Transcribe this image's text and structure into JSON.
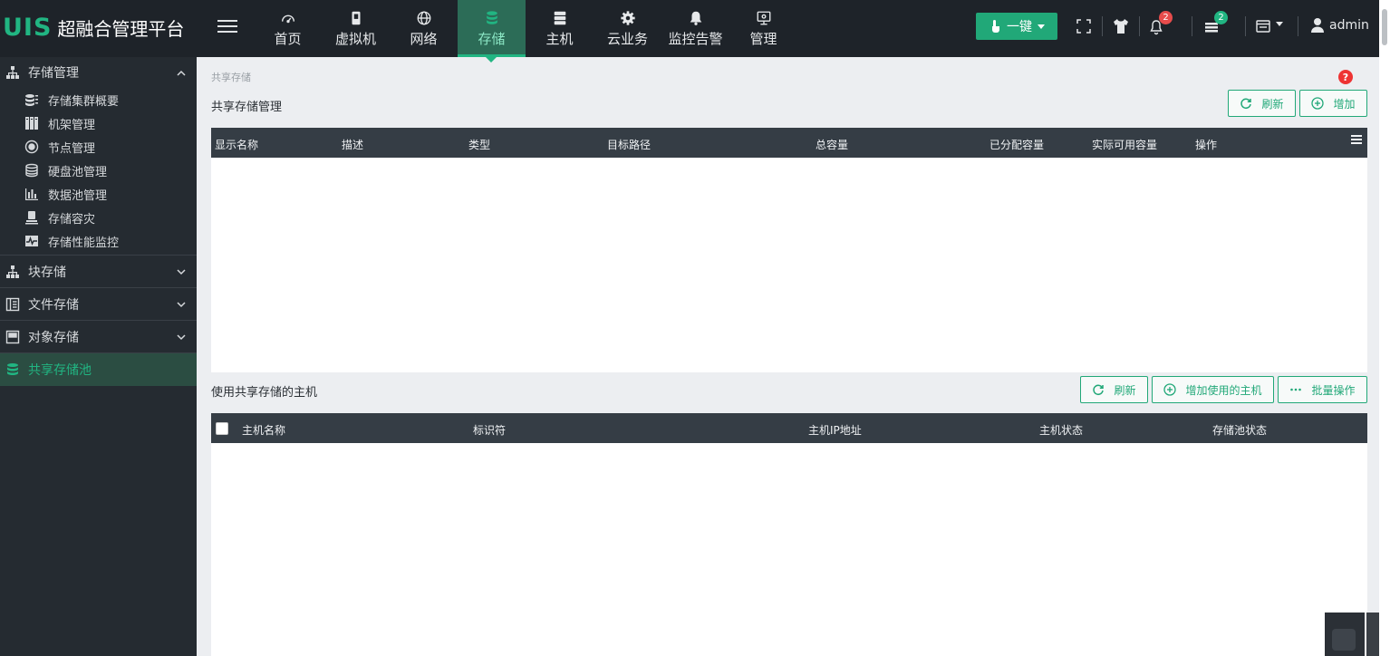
{
  "app": {
    "logo_mark": "UIS",
    "title": "超融合管理平台"
  },
  "nav": [
    {
      "label": "首页",
      "icon": "dashboard-icon"
    },
    {
      "label": "虚拟机",
      "icon": "vm-icon"
    },
    {
      "label": "网络",
      "icon": "globe-icon"
    },
    {
      "label": "存储",
      "icon": "database-icon",
      "active": true
    },
    {
      "label": "主机",
      "icon": "server-icon"
    },
    {
      "label": "云业务",
      "icon": "gear-icon"
    },
    {
      "label": "监控告警",
      "icon": "bell-alert-icon"
    },
    {
      "label": "管理",
      "icon": "monitor-icon"
    }
  ],
  "toolbar": {
    "yijian_label": "一键",
    "alerts_count": "2",
    "tasks_count": "2",
    "user_name": "admin"
  },
  "sidebar": {
    "storage_mgmt": {
      "label": "存储管理",
      "items": [
        {
          "label": "存储集群概要"
        },
        {
          "label": "机架管理"
        },
        {
          "label": "节点管理"
        },
        {
          "label": "硬盘池管理"
        },
        {
          "label": "数据池管理"
        },
        {
          "label": "存储容灾"
        },
        {
          "label": "存储性能监控"
        }
      ]
    },
    "block_storage": {
      "label": "块存储"
    },
    "file_storage": {
      "label": "文件存储"
    },
    "object_storage": {
      "label": "对象存储"
    },
    "shared_pool": {
      "label": "共享存储池"
    }
  },
  "main": {
    "breadcrumb": "共享存储",
    "help_label": "?",
    "section1": {
      "title": "共享存储管理",
      "refresh_label": "刷新",
      "add_label": "增加",
      "columns": [
        "显示名称",
        "描述",
        "类型",
        "目标路径",
        "总容量",
        "已分配容量",
        "实际可用容量",
        "操作"
      ]
    },
    "section2": {
      "title": "使用共享存储的主机",
      "refresh_label": "刷新",
      "add_host_label": "增加使用的主机",
      "batch_label": "批量操作",
      "columns": [
        "主机名称",
        "标识符",
        "主机IP地址",
        "主机状态",
        "存储池状态"
      ]
    }
  },
  "colors": {
    "accent": "#21b582",
    "topbar": "#1e2329",
    "sidebar": "#252b31",
    "table_header": "#353d45",
    "alert_badge": "#e74c4c"
  }
}
